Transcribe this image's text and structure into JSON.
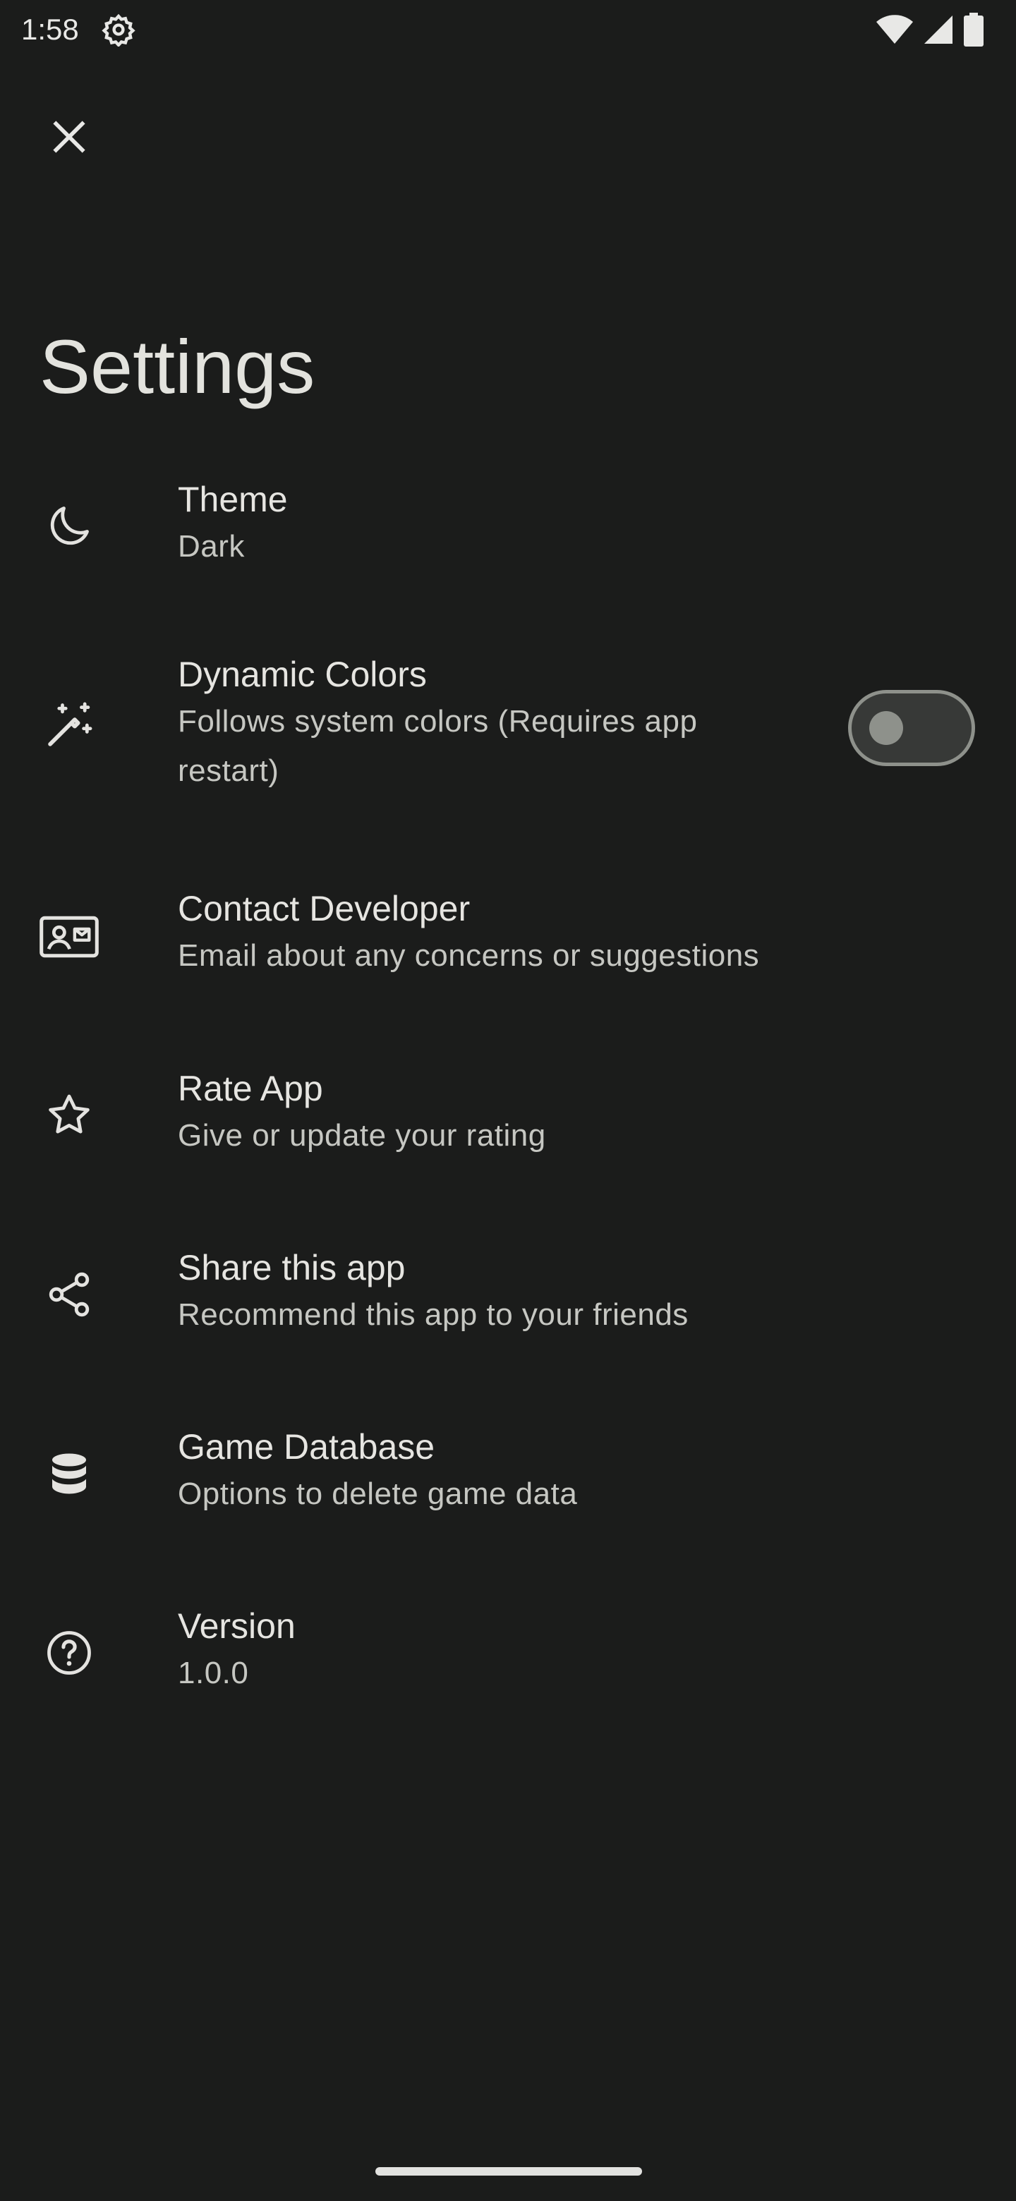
{
  "status_bar": {
    "time": "1:58",
    "icons": [
      "settings-gear-icon",
      "wifi-icon",
      "cellular-signal-icon",
      "battery-icon"
    ]
  },
  "toolbar": {
    "close_icon": "close-icon"
  },
  "page": {
    "title": "Settings"
  },
  "settings": {
    "items": [
      {
        "icon": "moon-icon",
        "title": "Theme",
        "subtitle": "Dark"
      },
      {
        "icon": "magic-wand-icon",
        "title": "Dynamic Colors",
        "subtitle_line1": "Follows system colors (Requires app",
        "subtitle_line2": "restart)",
        "toggle_state": "off"
      },
      {
        "icon": "contact-card-icon",
        "title": "Contact Developer",
        "subtitle": "Email about any concerns or suggestions"
      },
      {
        "icon": "star-icon",
        "title": "Rate App",
        "subtitle": "Give or update your rating"
      },
      {
        "icon": "share-icon",
        "title": "Share this app",
        "subtitle": "Recommend this app to your friends"
      },
      {
        "icon": "database-icon",
        "title": "Game Database",
        "subtitle": "Options to delete game data"
      },
      {
        "icon": "help-circle-icon",
        "title": "Version",
        "subtitle": "1.0.0"
      }
    ]
  },
  "colors": {
    "background": "#1b1c1b",
    "text_primary": "#e6e5e1",
    "text_secondary": "#c6c7c2",
    "toggle_outline": "#8e918b"
  }
}
